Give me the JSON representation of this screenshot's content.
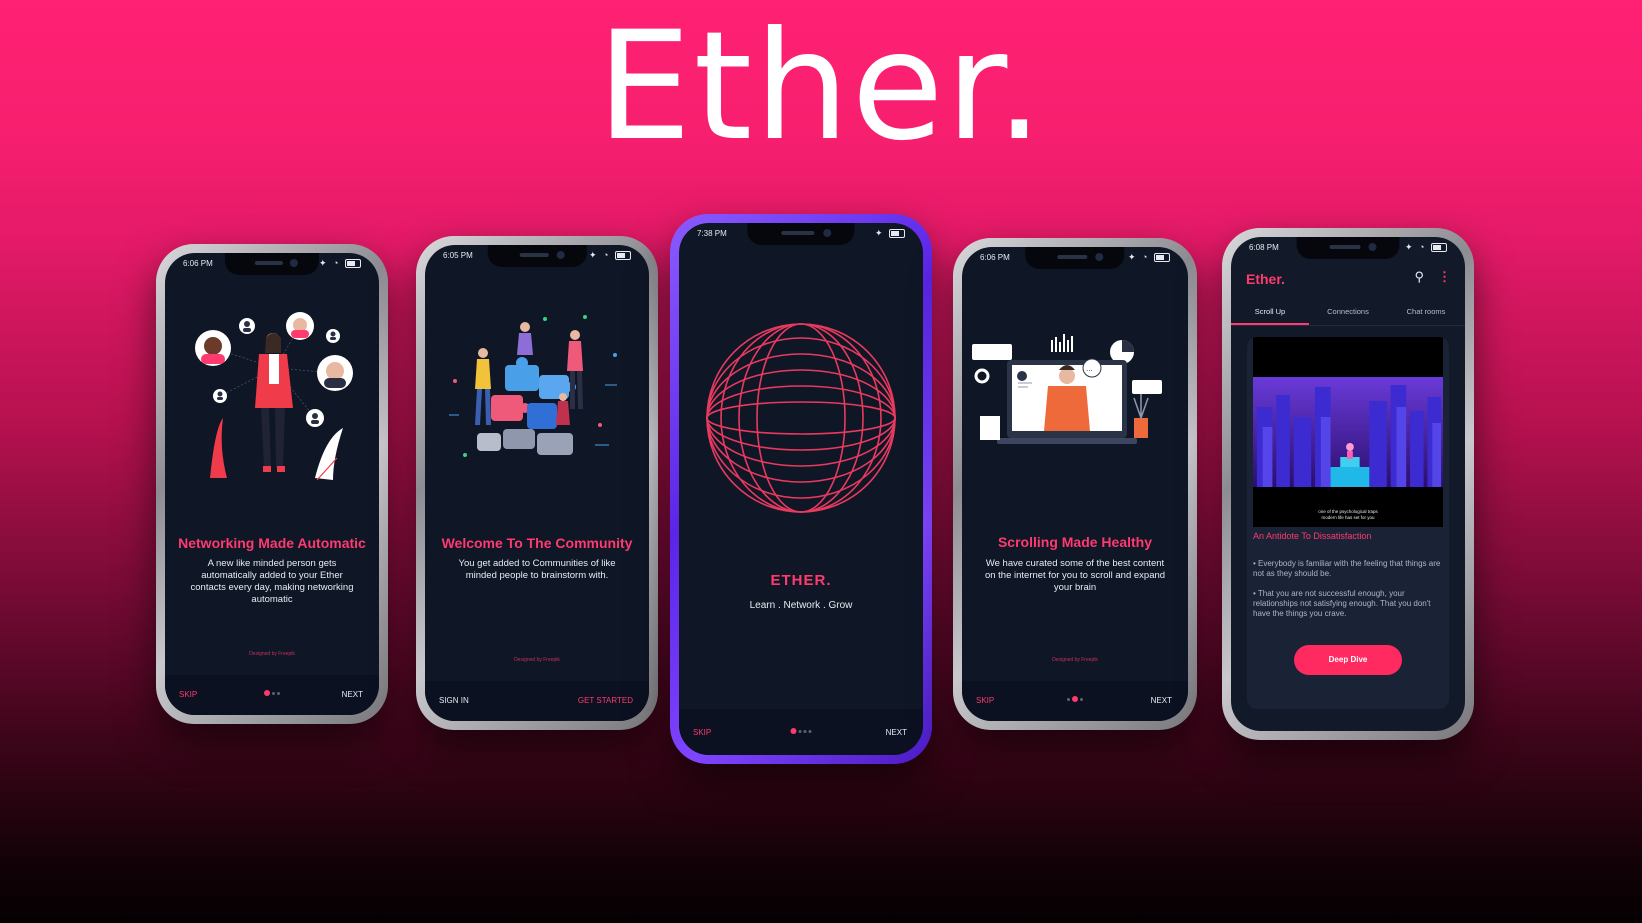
{
  "hero": {
    "title": "Ether."
  },
  "colors": {
    "accent": "#ff3a6e",
    "screen_bg": "#0f1626",
    "featured_frame": "#6a33ff"
  },
  "phones": [
    {
      "time": "6:06 PM",
      "title": "Networking Made Automatic",
      "body": "A new like minded person gets automatically added to your Ether contacts every day, making networking automatic",
      "credit": "Designed by Freepik",
      "nav_left": "SKIP",
      "nav_right": "NEXT",
      "illustration": "networking-illustration"
    },
    {
      "time": "6:05 PM",
      "title": "Welcome To The Community",
      "body": "You get added to Communities of like minded people to brainstorm with.",
      "credit": "Designed by Freepik",
      "nav_left": "SIGN IN",
      "nav_right": "GET STARTED",
      "illustration": "puzzle-community-illustration"
    },
    {
      "time": "7:38 PM",
      "title": "ETHER.",
      "tagline": "Learn . Network . Grow",
      "nav_left": "SKIP",
      "nav_right": "NEXT",
      "illustration": "wireframe-globe"
    },
    {
      "time": "6:06 PM",
      "title": "Scrolling Made Healthy",
      "body": "We have curated some of the best content on the internet for you to scroll and expand your brain",
      "credit": "Designed by Freepik",
      "nav_left": "SKIP",
      "nav_right": "NEXT",
      "illustration": "video-content-illustration"
    },
    {
      "time": "6:08 PM",
      "logo": "Ether.",
      "tabs": [
        "Scroll Up",
        "Connections",
        "Chat rooms"
      ],
      "video_caption_1": "one of the psychological traps",
      "video_caption_2": "modern life has set for you",
      "article_title": "An Antidote To Dissatisfaction",
      "bullet_1": "• Everybody is familiar with the feeling that things are not as they should be.",
      "bullet_2": "• That you are not successful enough, your relationships not satisfying enough. That you don't have the things you crave.",
      "cta": "Deep Dive"
    }
  ]
}
